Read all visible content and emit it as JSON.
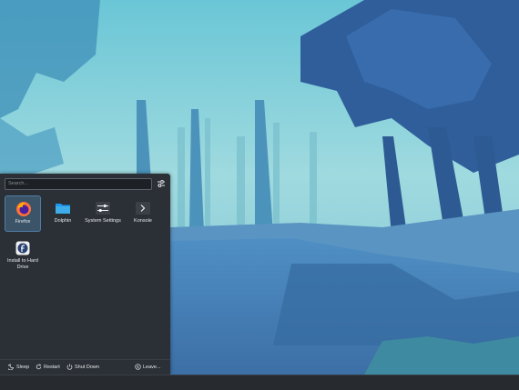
{
  "search": {
    "placeholder": "Search..."
  },
  "apps": [
    {
      "label": "Firefox",
      "icon": "firefox-icon",
      "selected": true
    },
    {
      "label": "Dolphin",
      "icon": "folder-icon"
    },
    {
      "label": "System Settings",
      "icon": "settings-icon"
    },
    {
      "label": "Konsole",
      "icon": "terminal-icon"
    },
    {
      "label": "Install to Hard Drive",
      "icon": "fedora-installer-icon"
    }
  ],
  "footer": {
    "sleep": "Sleep",
    "restart": "Restart",
    "shutdown": "Shut Down",
    "leave": "Leave..."
  },
  "colors": {
    "accent": "#3daee9",
    "panel": "#2b3036",
    "selected": "#3b5468"
  }
}
